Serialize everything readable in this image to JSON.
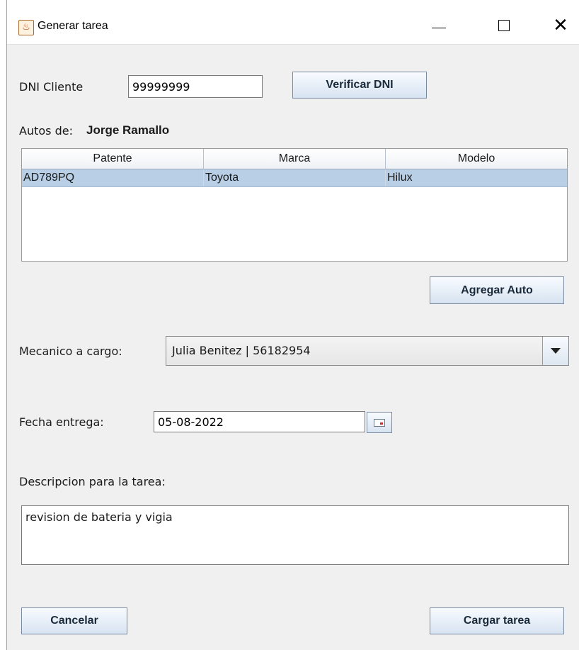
{
  "window": {
    "title": "Generar tarea",
    "minimize_icon": "minimize-icon",
    "maximize_icon": "maximize-icon",
    "close_glyph": "✕"
  },
  "dni": {
    "label": "DNI Cliente",
    "value": "99999999",
    "verify_button": "Verificar DNI"
  },
  "autos": {
    "label": "Autos de:",
    "owner": "Jorge Ramallo",
    "columns": [
      "Patente",
      "Marca",
      "Modelo"
    ],
    "rows": [
      [
        "AD789PQ",
        "Toyota",
        "Hilux"
      ]
    ],
    "add_button": "Agregar Auto"
  },
  "mecanico": {
    "label": "Mecanico a cargo:",
    "selected": "Julia Benitez | 56182954"
  },
  "fecha": {
    "label": "Fecha entrega:",
    "value": "05-08-2022"
  },
  "descripcion": {
    "label": "Descripcion para la tarea:",
    "value": "revision de bateria y vigia"
  },
  "actions": {
    "cancel": "Cancelar",
    "submit": "Cargar tarea"
  },
  "colors": {
    "selected_row": "#b8cfe5",
    "button_top": "#f8fbff",
    "button_bottom": "#d7e3f1"
  }
}
